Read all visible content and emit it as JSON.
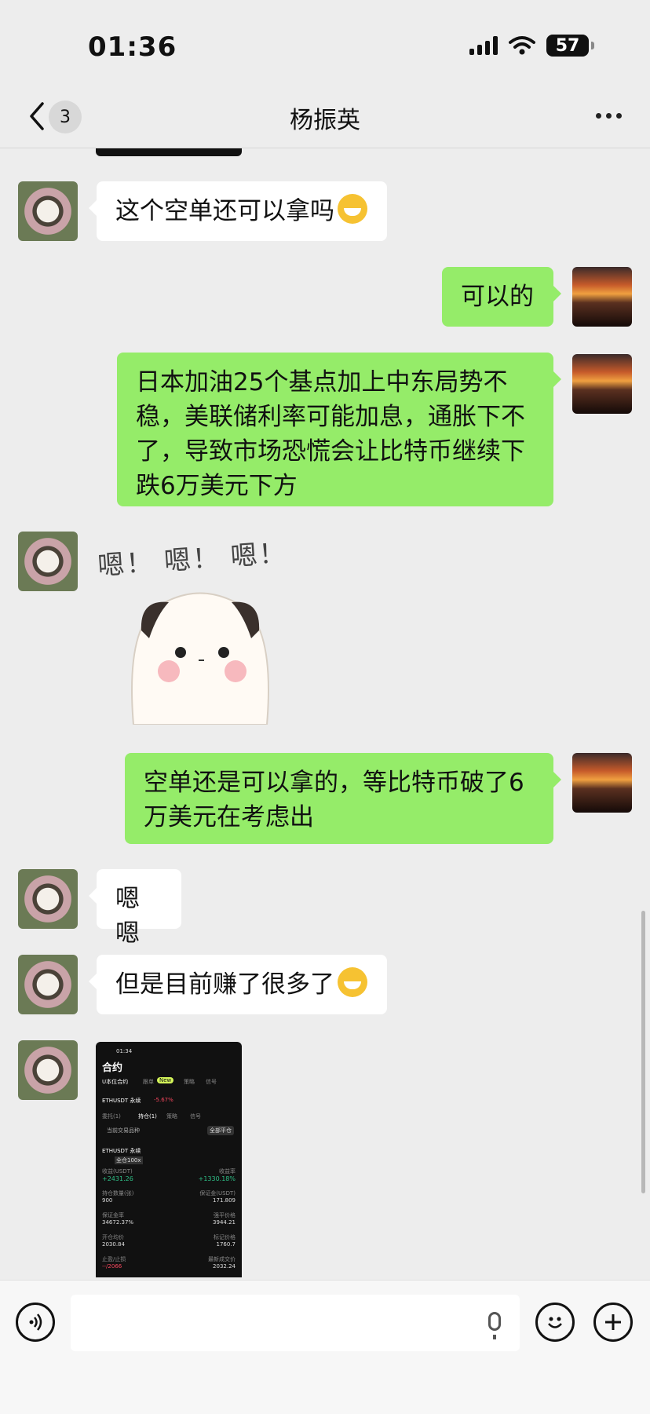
{
  "status": {
    "time": "01:36",
    "battery": "57"
  },
  "header": {
    "back_count": "3",
    "title": "杨振英"
  },
  "messages": [
    {
      "side": "left",
      "text": "这个空单还可以拿吗"
    },
    {
      "side": "right",
      "text": "可以的"
    },
    {
      "side": "right",
      "text": "日本加油25个基点加上中东局势不稳，美联储利率可能加息，通胀下不了，导致市场恐慌会让比特币继续下跌6万美元下方"
    },
    {
      "side": "left",
      "sticker_text": "嗯！ 嗯！ 嗯！"
    },
    {
      "side": "right",
      "text": "空单还是可以拿的，等比特币破了6万美元在考虑出"
    },
    {
      "side": "left",
      "text": "嗯嗯"
    },
    {
      "side": "left",
      "text": "但是目前赚了很多了"
    }
  ],
  "screenshot": {
    "time": "01:34",
    "title": "合约",
    "tabs": [
      "U本位合约",
      "跟单",
      "New",
      "策略",
      "信号"
    ],
    "pair": "ETHUSDT 永续",
    "change": "-5.67%",
    "subtabs": [
      "委托(1)",
      "持仓(1)",
      "策略",
      "信号"
    ],
    "filter": "当前交易品种",
    "close_all": "全部平仓",
    "position": "ETHUSDT 永续",
    "tag": "全仓100x",
    "pnl_label": "收益(USDT)",
    "pnl": "+2431.26",
    "roe_label": "收益率",
    "roe": "+1330.18%",
    "rows": [
      {
        "l_label": "持仓数量(张)",
        "l": "900",
        "r_label": "保证金(USDT)",
        "r": "171.809"
      },
      {
        "l_label": "保证金率",
        "l": "34672.37%",
        "r_label": "强平价格",
        "r": "3944.21"
      },
      {
        "l_label": "开仓均价",
        "l": "2030.84",
        "r_label": "标记价格",
        "r": "1760.7"
      },
      {
        "l_label": "止盈/止损",
        "l": "--/2066",
        "r_label": "最新成交价",
        "r": "2032.24"
      }
    ]
  },
  "colors": {
    "bubble_right": "#95ec69",
    "bubble_left": "#ffffff",
    "background": "#ededed",
    "profit_green": "#2ebd85"
  }
}
